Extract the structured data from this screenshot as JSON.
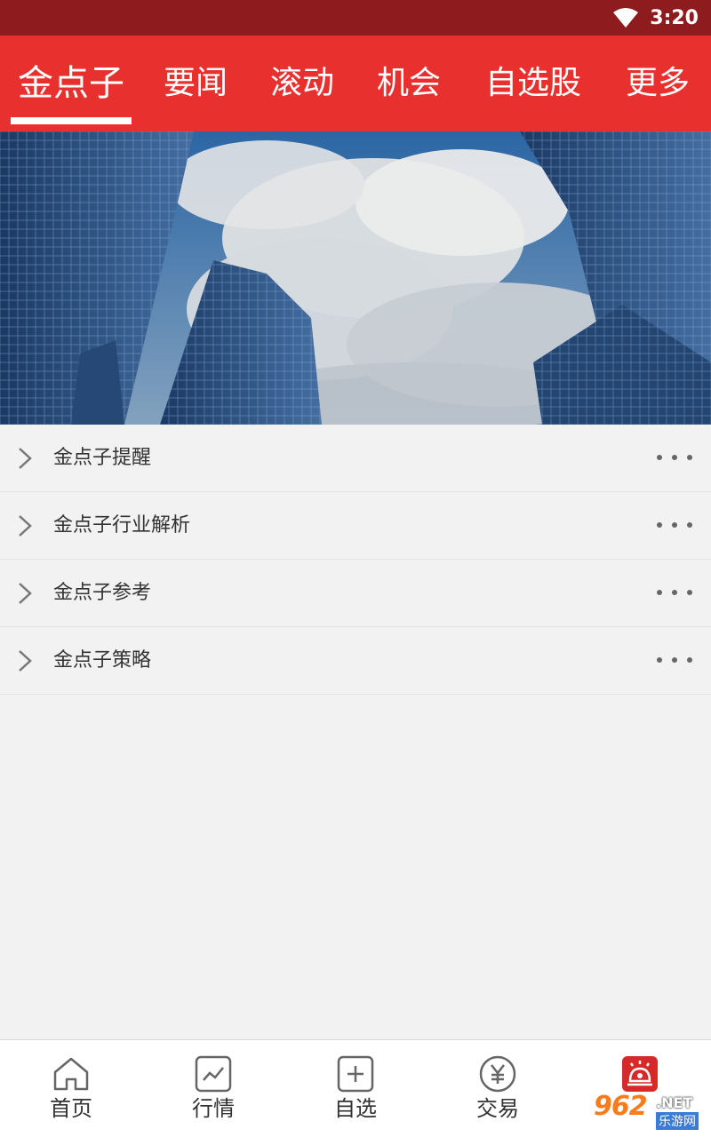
{
  "status_bar": {
    "time": "3:20"
  },
  "tabs": [
    {
      "label": "金点子",
      "active": true
    },
    {
      "label": "要闻"
    },
    {
      "label": "滚动"
    },
    {
      "label": "机会"
    },
    {
      "label": "自选股"
    },
    {
      "label": "更多"
    }
  ],
  "list": {
    "items": [
      {
        "label": "金点子提醒"
      },
      {
        "label": "金点子行业解析"
      },
      {
        "label": "金点子参考"
      },
      {
        "label": "金点子策略"
      }
    ]
  },
  "bottom_nav": {
    "items": [
      {
        "label": "首页",
        "icon": "home-icon"
      },
      {
        "label": "行情",
        "icon": "chart-icon"
      },
      {
        "label": "自选",
        "icon": "add-icon"
      },
      {
        "label": "交易",
        "icon": "yuan-icon"
      },
      {
        "label": "",
        "icon": "alarm-icon"
      }
    ]
  },
  "watermark": {
    "num": "962",
    "net": ".NET",
    "cn": "乐游网"
  },
  "colors": {
    "header_red": "#e8302f",
    "status_red": "#8e1b1e",
    "accent": "#d62a2a"
  }
}
